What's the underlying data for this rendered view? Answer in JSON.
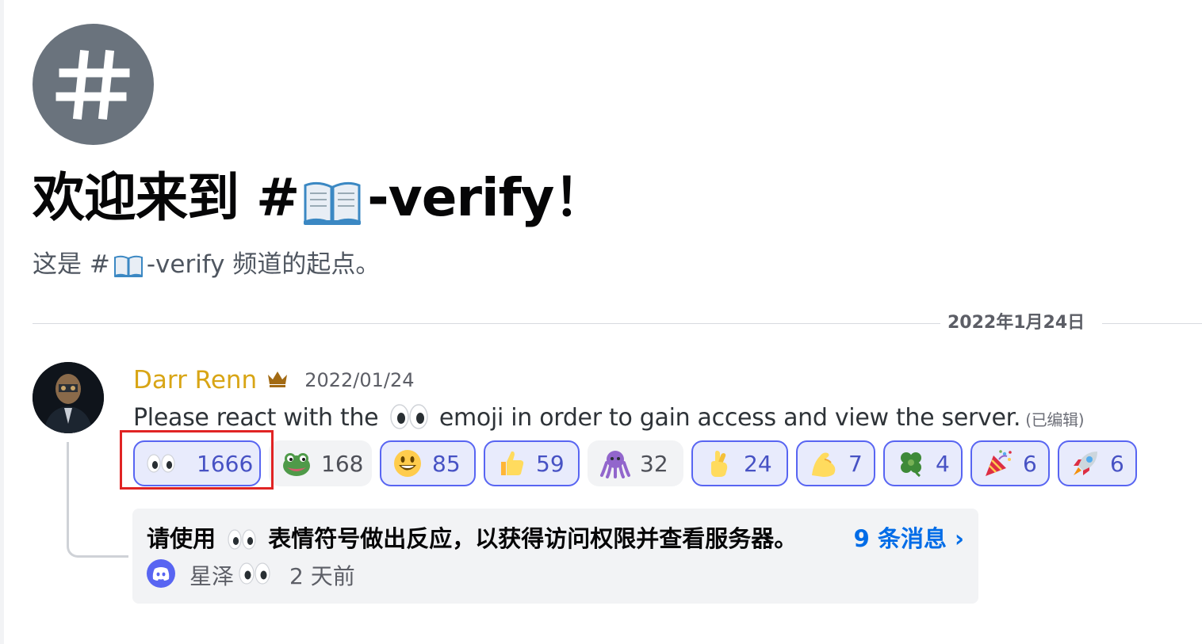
{
  "channel": {
    "hero_icon": "hash-icon",
    "welcome_title_prefix": "欢迎来到 #",
    "channel_emoji": "open-book-emoji",
    "welcome_title_suffix": "-verify！",
    "subtitle_prefix": "这是 #",
    "subtitle_suffix": "-verify 频道的起点。"
  },
  "date_divider": "2022年1月24日",
  "message": {
    "author": "Darr Renn",
    "author_color": "#d8a515",
    "author_badge": "crown-icon",
    "timestamp": "2022/01/24",
    "body_prefix": "Please react with  the",
    "body_suffix": "emoji in order to gain access and view the server.",
    "edited": "(已编辑)",
    "reactions": [
      {
        "emoji": "eyes-emoji",
        "count": "1666",
        "reacted": true
      },
      {
        "emoji": "pepe-frog-emoji",
        "count": "168",
        "reacted": false
      },
      {
        "emoji": "smiley-emoji",
        "count": "85",
        "reacted": true
      },
      {
        "emoji": "thumbs-up-emoji",
        "count": "59",
        "reacted": true
      },
      {
        "emoji": "octopus-emoji",
        "count": "32",
        "reacted": false
      },
      {
        "emoji": "crossed-fingers-emoji",
        "count": "24",
        "reacted": true
      },
      {
        "emoji": "flexed-biceps-emoji",
        "count": "7",
        "reacted": true
      },
      {
        "emoji": "four-leaf-clover-emoji",
        "count": "4",
        "reacted": true
      },
      {
        "emoji": "party-popper-emoji",
        "count": "6",
        "reacted": true
      },
      {
        "emoji": "rocket-emoji",
        "count": "6",
        "reacted": true
      }
    ]
  },
  "thread": {
    "title_prefix": "请使用",
    "title_suffix": "表情符号做出反应，以获得访问权限并查看服务器。",
    "count_label": "9 条消息 ›",
    "author": "星泽",
    "time": "2 天前",
    "author_icon": "discord-icon"
  },
  "colors": {
    "accent": "#5865f2",
    "link": "#006ce7",
    "highlight": "#e02424"
  }
}
